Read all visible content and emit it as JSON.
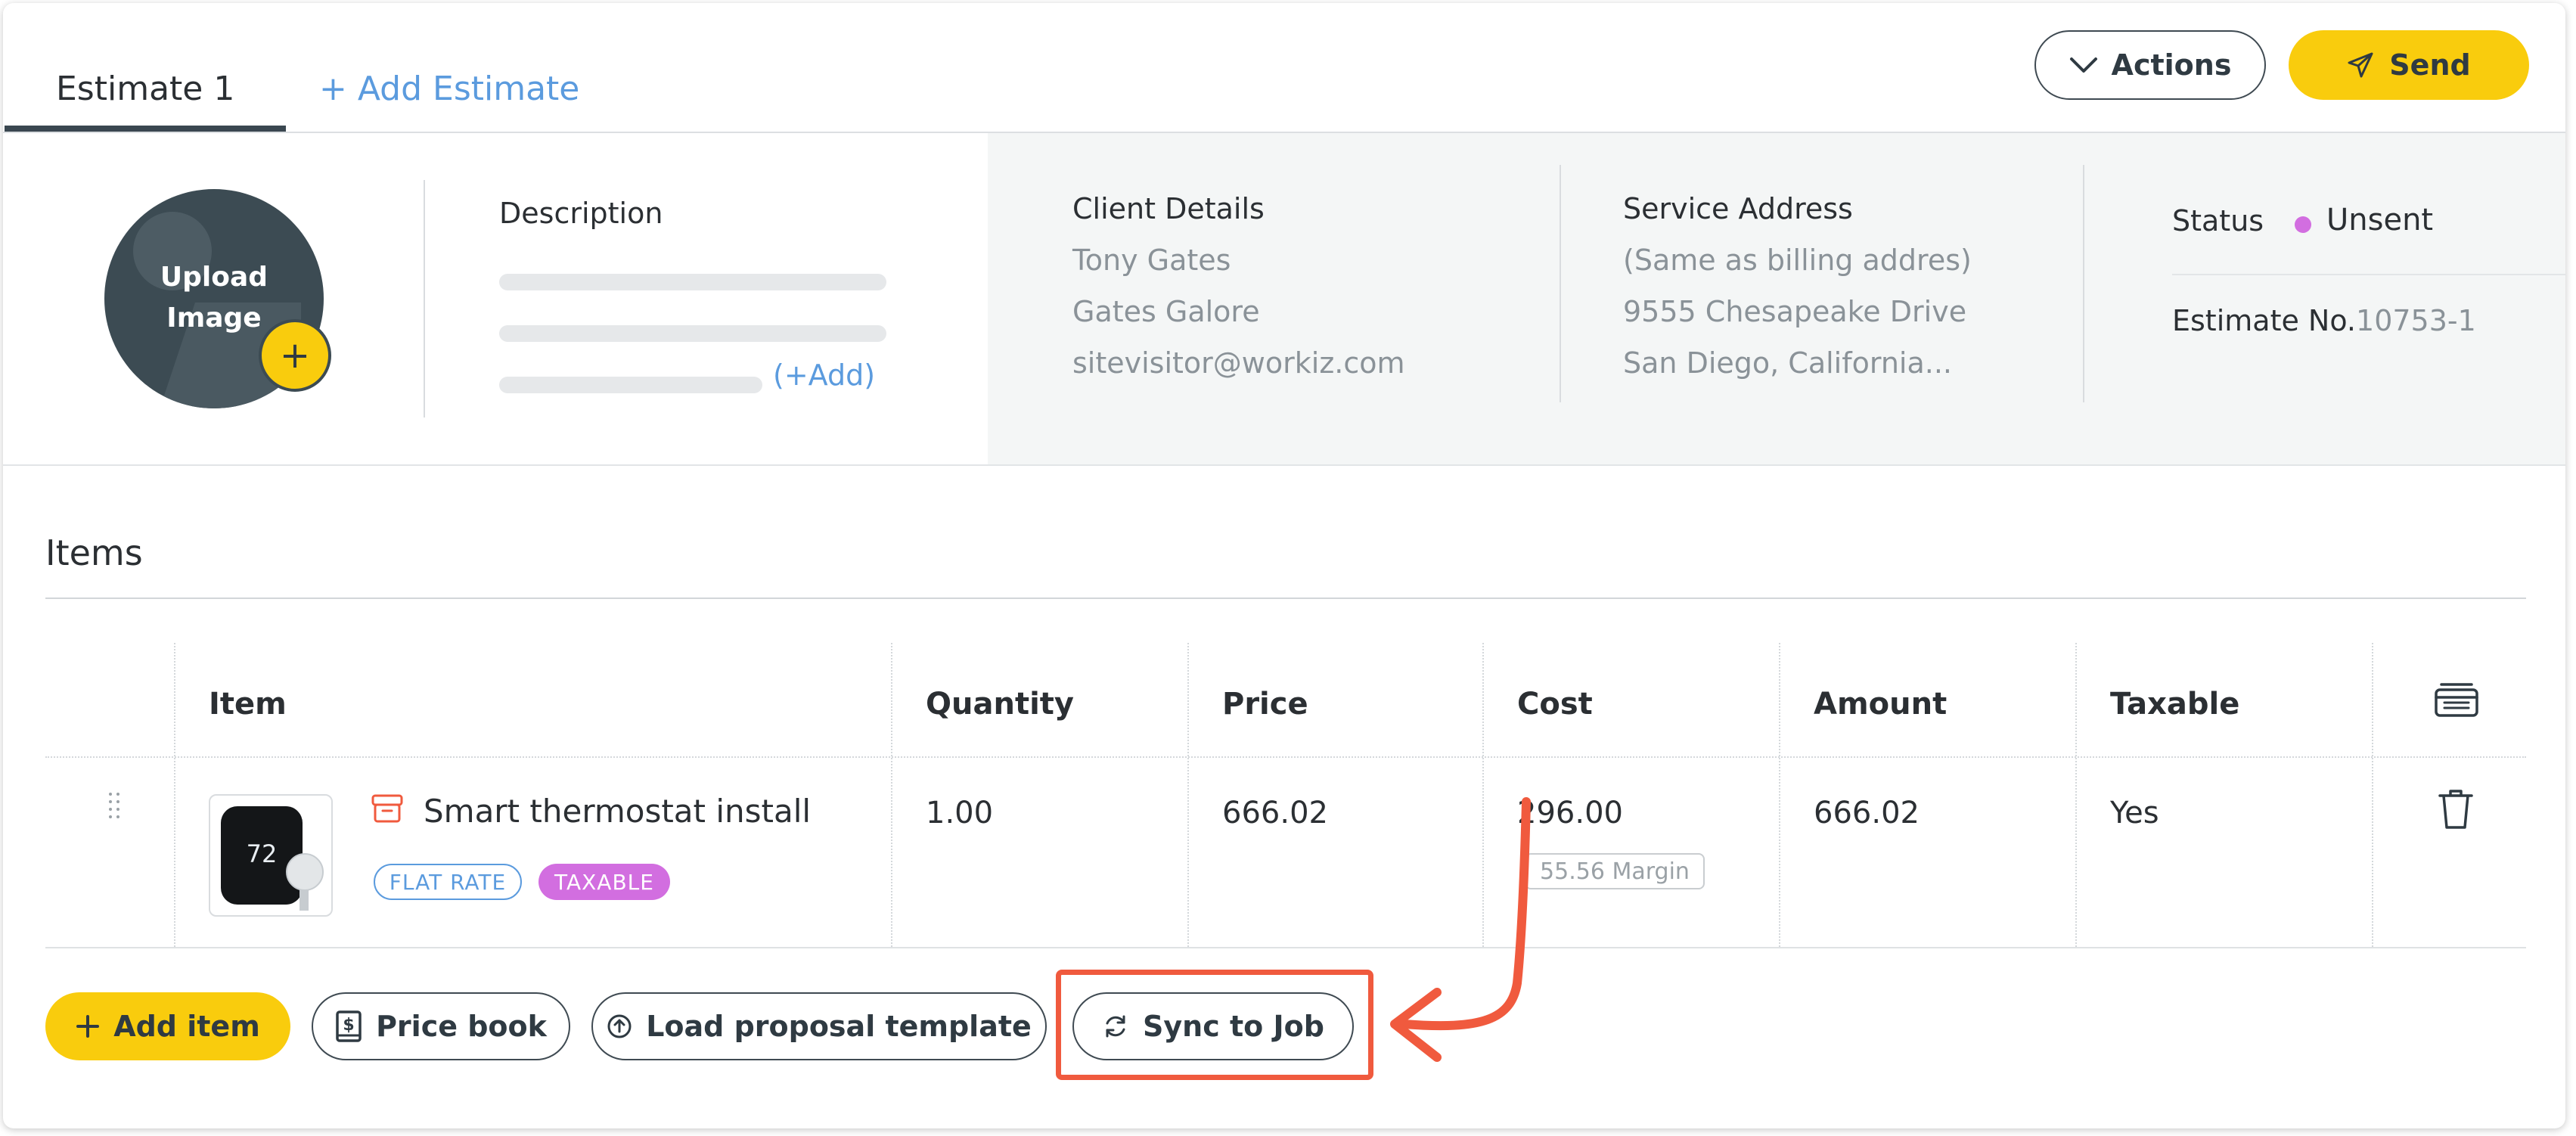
{
  "tabs": {
    "active": "Estimate 1",
    "add": "+ Add Estimate"
  },
  "header_buttons": {
    "actions": "Actions",
    "send": "Send"
  },
  "upload": {
    "line1": "Upload",
    "line2": "Image",
    "plus": "+"
  },
  "description": {
    "label": "Description",
    "add": "(+Add)"
  },
  "client": {
    "title": "Client Details",
    "name": "Tony Gates",
    "company": "Gates Galore",
    "email": "sitevisitor@workiz.com"
  },
  "service": {
    "title": "Service Address",
    "note": "(Same as billing addres)",
    "street": "9555 Chesapeake Drive",
    "city": "San Diego, California..."
  },
  "status": {
    "label": "Status",
    "value": "Unsent",
    "estimate_label": "Estimate No.",
    "estimate_no": "10753-1",
    "dot_color": "#d26ee0"
  },
  "items": {
    "title": "Items",
    "columns": [
      "Item",
      "Quantity",
      "Price",
      "Cost",
      "Amount",
      "Taxable"
    ],
    "rows": [
      {
        "name": "Smart thermostat install",
        "thumb_display": "72",
        "badges": [
          "FLAT RATE",
          "TAXABLE"
        ],
        "quantity": "1.00",
        "price": "666.02",
        "cost": "296.00",
        "margin": "55.56 Margin",
        "amount": "666.02",
        "taxable": "Yes"
      }
    ]
  },
  "footer_buttons": {
    "add_item": "Add item",
    "price_book": "Price book",
    "load_template": "Load proposal template",
    "sync": "Sync to Job"
  },
  "colors": {
    "accent": "#f9cc0d",
    "link": "#5b9bde",
    "annotation": "#f05a3e",
    "taxable_badge": "#d26ee0"
  },
  "icons": [
    "chevron-down-icon",
    "send-icon",
    "plus-icon",
    "item-type-icon",
    "columns-icon",
    "trash-icon",
    "drag-handle-icon",
    "price-book-icon",
    "upload-icon",
    "sync-icon"
  ]
}
